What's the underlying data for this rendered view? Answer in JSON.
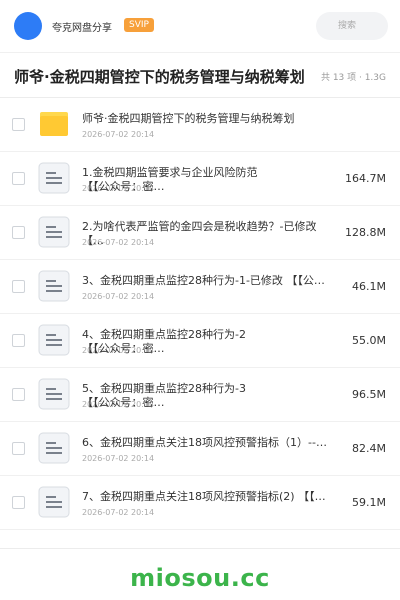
{
  "header": {
    "user_name": "夸克网盘分享",
    "badge": "SVIP",
    "search_placeholder": "搜索"
  },
  "folder": {
    "title": "师爷·金税四期管控下的税务管理与纳税筹划",
    "meta": "共 13 项 · 1.3G"
  },
  "items": [
    {
      "type": "folder",
      "name": "师爷·金税四期管控下的税务管理与纳税筹划",
      "name2": "",
      "date": "2026-07-02 20:14",
      "size": ""
    },
    {
      "type": "file",
      "name": "1.金税四期监管要求与企业风险防范",
      "name2": "【【公众号：密…",
      "date": "2026-07-02 20:14",
      "size": "164.7M"
    },
    {
      "type": "file",
      "name": "2.为啥代表严监管的金四会是税收趋势？-已修改",
      "name2": "【…",
      "date": "2026-07-02 20:14",
      "size": "128.8M"
    },
    {
      "type": "file",
      "name": "3、金税四期重点监控28种行为-1-已修改 【【公…",
      "name2": "",
      "date": "2026-07-02 20:14",
      "size": "46.1M"
    },
    {
      "type": "file",
      "name": "4、金税四期重点监控28种行为-2",
      "name2": "【【公众号：密…",
      "date": "2026-07-02 20:14",
      "size": "55.0M"
    },
    {
      "type": "file",
      "name": "5、金税四期重点监控28种行为-3",
      "name2": "【【公众号：密…",
      "date": "2026-07-02 20:14",
      "size": "96.5M"
    },
    {
      "type": "file",
      "name": "6、金税四期重点关注18项风控预警指标（1）--已…",
      "name2": "",
      "date": "2026-07-02 20:14",
      "size": "82.4M"
    },
    {
      "type": "file",
      "name": "7、金税四期重点关注18项风控预警指标(2) 【【…",
      "name2": "",
      "date": "2026-07-02 20:14",
      "size": "59.1M"
    }
  ],
  "watermark": "miosou.cc",
  "colors": {
    "accent": "#2d7cf6",
    "badge": "#f7a03a",
    "watermark": "#3cb44b",
    "folder": "#ffc933"
  }
}
